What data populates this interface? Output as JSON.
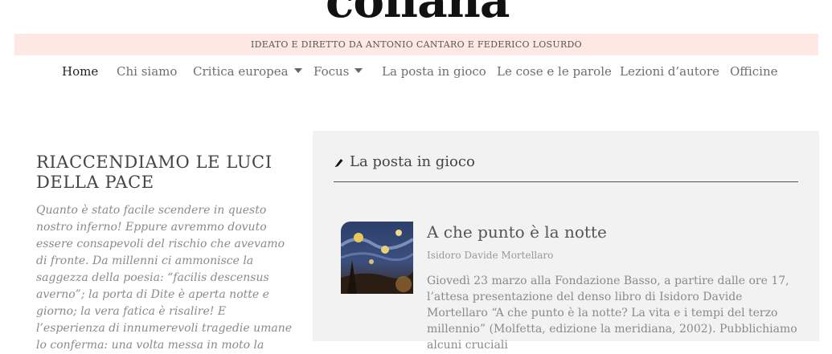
{
  "site": {
    "logo_text": "collana"
  },
  "banner": {
    "text": "IDEATO E DIRETTO DA ANTONIO CANTARO E FEDERICO LOSURDO"
  },
  "nav": {
    "items": [
      {
        "label": "Home"
      },
      {
        "label": "Chi siamo"
      },
      {
        "label": "Critica europea"
      },
      {
        "label": "Focus"
      },
      {
        "label": "La posta in gioco"
      },
      {
        "label": "Le cose e le parole"
      },
      {
        "label": "Lezioni d’autore"
      },
      {
        "label": "Officine"
      }
    ]
  },
  "left": {
    "title": "RIACCENDIAMO LE LUCI DELLA PACE",
    "body": "Quanto è stato facile scendere in questo nostro inferno! Eppure avremmo dovuto essere consapevoli del rischio che avevamo di fronte. Da millenni ci ammonisce la saggezza della poesia: “facilis descensus averno”; la porta di Dite è aperta notte e giorno; la vera fatica è risalire! E l’esperienza di innumerevoli tragedie umane lo conferma: una volta messa in moto la"
  },
  "panel": {
    "title": "La posta in gioco",
    "article": {
      "title": "A che punto è la notte",
      "author": "Isidoro Davide Mortellaro",
      "excerpt": "Giovedì 23 marzo alla Fondazione Basso, a partire dalle ore 17, l’attesa presentazione del denso libro di Isidoro Davide Mortellaro “A che punto è la notte? La vita e i tempi del terzo millennio” (Molfetta, edizione la meridiana, 2002). Pubblichiamo alcuni cruciali"
    }
  },
  "colors": {
    "banner_bg": "#fde8e3",
    "panel_bg": "#f2f2f2",
    "nav_text": "#6e6e6e",
    "nav_active": "#222222"
  },
  "icons": {
    "dropdown": "caret-down-icon",
    "section": "pen-icon"
  }
}
